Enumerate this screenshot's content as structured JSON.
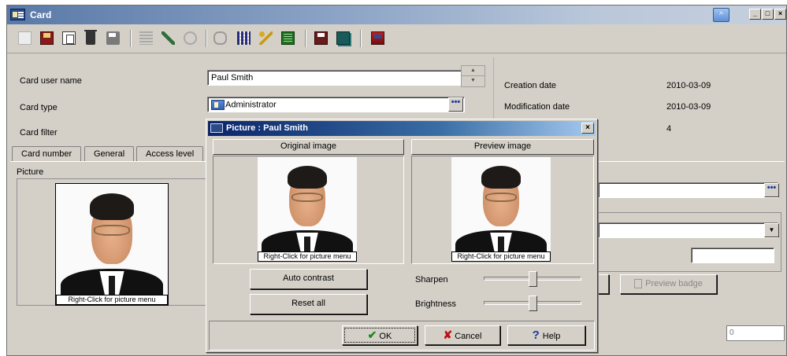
{
  "window": {
    "title": "Card"
  },
  "form": {
    "user_name_label": "Card user name",
    "user_name_value": "Paul Smith",
    "card_type_label": "Card type",
    "card_type_value": "Administrator",
    "card_filter_label": "Card filter",
    "ellipsis": "•••"
  },
  "info": {
    "creation_label": "Creation date",
    "creation_value": "2010-03-09",
    "modification_label": "Modification date",
    "modification_value": "2010-03-09",
    "count_value": "4"
  },
  "tabs": [
    "Card number",
    "General",
    "Access level"
  ],
  "picture": {
    "label": "Picture",
    "caption": "Right-Click for picture menu"
  },
  "right": {
    "preview_badge_label": "Preview badge",
    "bottom_value": "0"
  },
  "dialog": {
    "title": "Picture : Paul Smith",
    "original_label": "Original image",
    "preview_label": "Preview image",
    "auto_contrast": "Auto contrast",
    "reset_all": "Reset all",
    "sharpen_label": "Sharpen",
    "brightness_label": "Brightness",
    "sharpen_level": 0.5,
    "brightness_level": 0.5,
    "ok": "OK",
    "cancel": "Cancel",
    "help": "Help"
  },
  "icons": {
    "toolbar": [
      "new-icon",
      "save-icon",
      "copy-icon",
      "delete-icon",
      "print-icon",
      "list-icon",
      "tools-icon",
      "search-icon",
      "binoculars-icon",
      "grid-icon",
      "key-icon",
      "spreadsheet-icon",
      "disk-icon",
      "stack-icon",
      "export-icon"
    ]
  }
}
